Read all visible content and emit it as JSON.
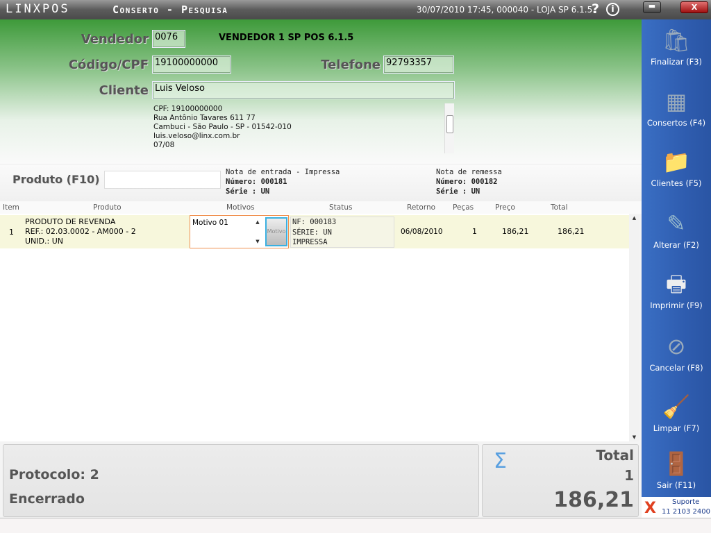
{
  "titlebar": {
    "logo": "LINXPOS",
    "title": "Conserto - Pesquisa",
    "info": "30/07/2010 17:45, 000040 - LOJA SP 6.1.5.",
    "help": "?",
    "info_icon": "i",
    "minimize": "▬",
    "close": "X"
  },
  "form": {
    "vendedor_label": "Vendedor",
    "vendedor_code": "0076",
    "vendedor_name": "VENDEDOR 1 SP POS 6.1.5",
    "codigo_label": "Código/CPF",
    "codigo_value": "19100000000",
    "telefone_label": "Telefone",
    "telefone_value": "92793357",
    "cliente_label": "Cliente",
    "cliente_value": "Luis Veloso",
    "address_lines": [
      "CPF: 19100000000",
      "Rua Antônio Tavares 611 77",
      "Cambuci - São Paulo - SP - 01542-010",
      "luis.veloso@linx.com.br",
      "07/08"
    ]
  },
  "produto": {
    "label": "Produto (F10)",
    "value": "",
    "nota_entrada": {
      "title": "Nota de entrada - Impressa",
      "numero": "Número: 000181",
      "serie": "Série : UN"
    },
    "nota_remessa": {
      "title": "Nota de remessa",
      "numero": "Número: 000182",
      "serie": "Série : UN"
    }
  },
  "table": {
    "columns": [
      "Item",
      "Produto",
      "Motivos",
      "Status",
      "Retorno",
      "Peças",
      "Preço",
      "Total"
    ],
    "rows": [
      {
        "item": "1",
        "produto": [
          "PRODUTO DE REVENDA",
          "REF.: 02.03.0002 - AM000 - 2",
          "UNID.: UN"
        ],
        "motivo": "Motivo 01",
        "motivo_button": "Motivo",
        "status": [
          "NF: 000183",
          "SÉRIE: UN",
          "IMPRESSA"
        ],
        "retorno": "06/08/2010",
        "pecas": "1",
        "preco": "186,21",
        "total": "186,21"
      }
    ]
  },
  "sidebar": {
    "items": [
      {
        "label": "Finalizar (F3)",
        "icon": "shopping-bag-icon"
      },
      {
        "label": "Consertos (F4)",
        "icon": "document-icon"
      },
      {
        "label": "Clientes (F5)",
        "icon": "folder-users-icon"
      },
      {
        "label": "Alterar (F2)",
        "icon": "edit-icon"
      },
      {
        "label": "Imprimir (F9)",
        "icon": "printer-icon"
      },
      {
        "label": "Cancelar (F8)",
        "icon": "cancel-icon"
      },
      {
        "label": "Limpar (F7)",
        "icon": "broom-icon"
      },
      {
        "label": "Sair (F11)",
        "icon": "exit-door-icon"
      }
    ]
  },
  "support": {
    "label": "Suporte",
    "phone": "11 2103 2400"
  },
  "summary": {
    "protocolo": "Protocolo: 2",
    "status": "Encerrado",
    "total_label": "Total",
    "quantity": "1",
    "total_value": "186,21",
    "sigma": "Σ"
  },
  "colors": {
    "sidebar": "#3266bb",
    "header_green": "#3e9a3a",
    "row_highlight": "#f7f7dc"
  }
}
